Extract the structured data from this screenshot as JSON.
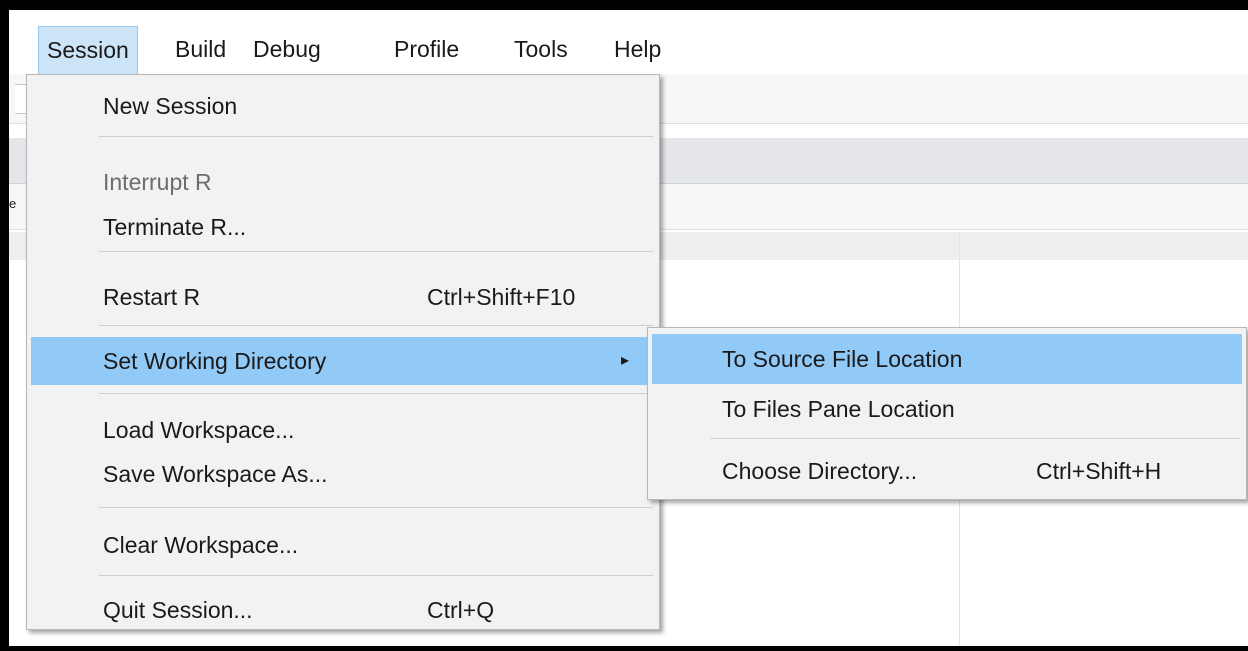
{
  "menubar": {
    "items": [
      "Session",
      "Build",
      "Debug",
      "Profile",
      "Tools",
      "Help"
    ]
  },
  "background": {
    "tab_glyph": "e"
  },
  "session_menu": {
    "new_session": "New Session",
    "interrupt_r": "Interrupt R",
    "terminate_r": "Terminate R...",
    "restart_r": "Restart R",
    "restart_r_shortcut": "Ctrl+Shift+F10",
    "set_working_directory": "Set Working Directory",
    "load_workspace": "Load Workspace...",
    "save_workspace_as": "Save Workspace As...",
    "clear_workspace": "Clear Workspace...",
    "quit_session": "Quit Session...",
    "quit_session_shortcut": "Ctrl+Q"
  },
  "working_directory_submenu": {
    "to_source_file_location": "To Source File Location",
    "to_files_pane_location": "To Files Pane Location",
    "choose_directory": "Choose Directory...",
    "choose_directory_shortcut": "Ctrl+Shift+H"
  },
  "colors": {
    "highlight": "#91c9f7",
    "open_menu_title": "#cce4f7",
    "menu_background": "#f2f2f2",
    "disabled_text": "#6d6d6d"
  },
  "icons": {
    "submenu_arrow": "triangle-right-icon"
  }
}
